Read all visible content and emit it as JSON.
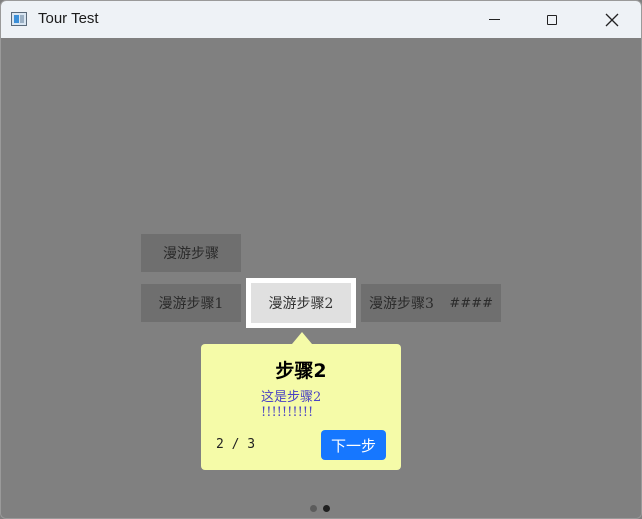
{
  "window": {
    "title": "Tour Test",
    "controls": {
      "minimize": "minimize",
      "maximize": "maximize",
      "close": "close"
    }
  },
  "buttons": {
    "top": "漫游步骤",
    "step1": "漫游步骤1",
    "step2": "漫游步骤2",
    "step3": "漫游步骤3",
    "hash": "####"
  },
  "tour": {
    "title": "步骤2",
    "body_line1": "这是步骤2",
    "body_line2": "!!!!!!!!!!",
    "counter": "2 / 3",
    "next_label": "下一步",
    "current_step": 2,
    "total_steps": 3,
    "dots": [
      {
        "active": false
      },
      {
        "active": true
      }
    ]
  },
  "colors": {
    "mask": "#808080",
    "popover_bg": "#f5fba8",
    "primary": "#1677ff",
    "body_text": "#4a42c4"
  }
}
